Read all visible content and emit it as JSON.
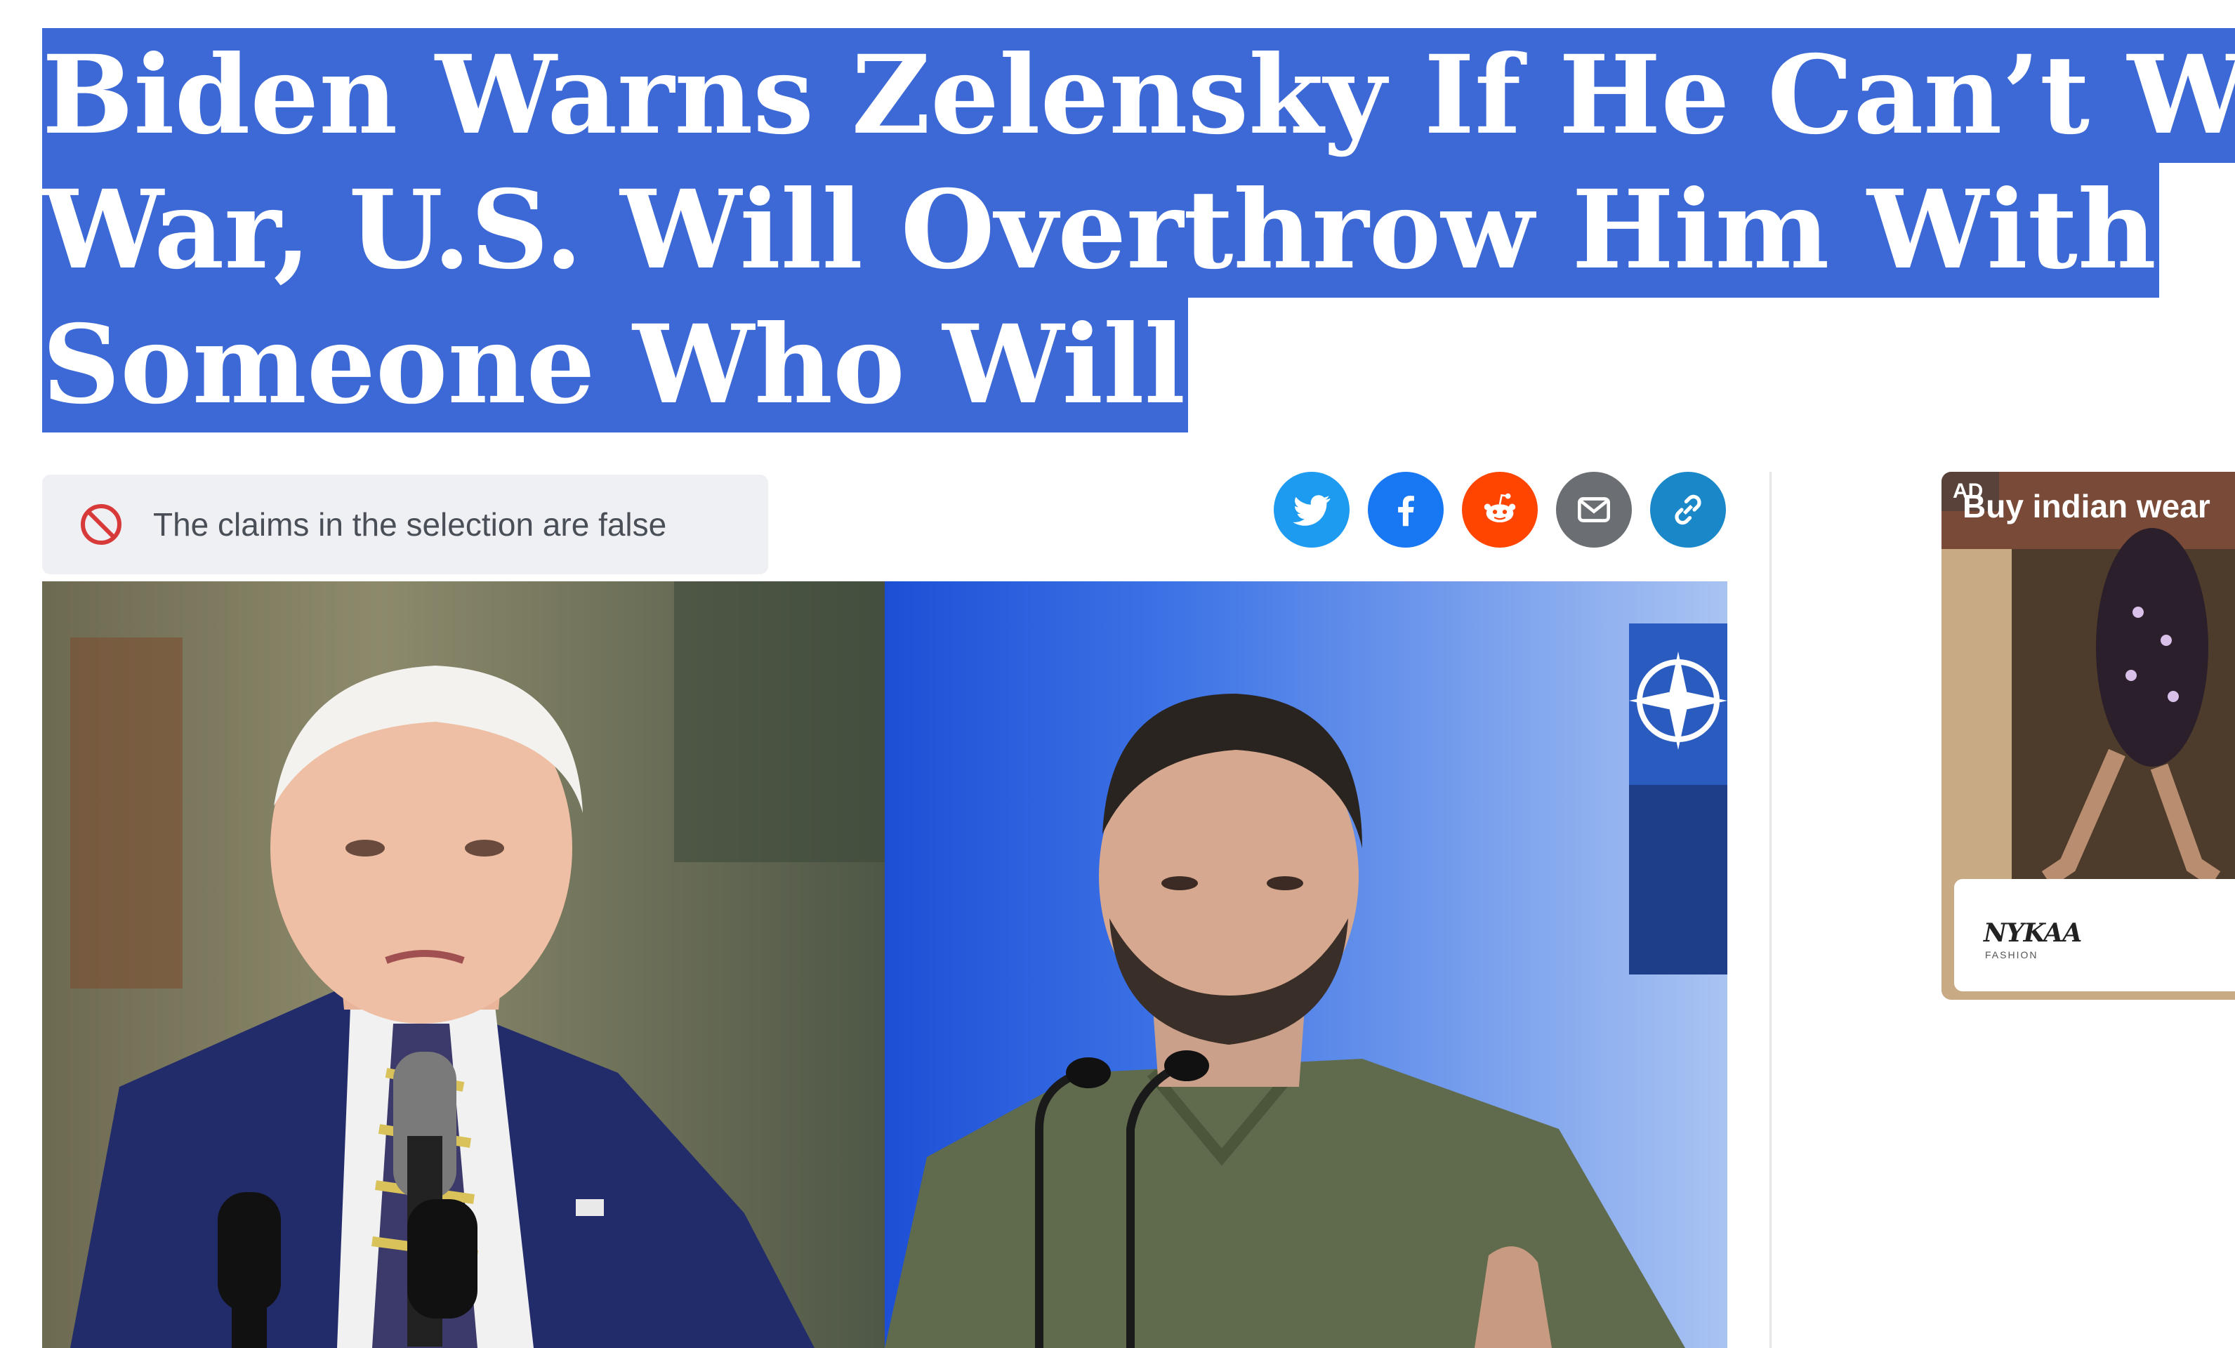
{
  "article": {
    "headline_lines": [
      "Biden Warns Zelensky If He Can’t Win",
      "War, U.S. Will Overthrow Him With",
      "Someone Who Will"
    ]
  },
  "claim": {
    "icon": "prohibited-icon",
    "text": "The claims in the selection are false"
  },
  "share": {
    "buttons": [
      {
        "name": "twitter",
        "icon": "twitter-icon",
        "color": "#1d9bf0"
      },
      {
        "name": "facebook",
        "icon": "facebook-icon",
        "color": "#1877f2"
      },
      {
        "name": "reddit",
        "icon": "reddit-icon",
        "color": "#ff4500"
      },
      {
        "name": "email",
        "icon": "email-icon",
        "color": "#6b6e73"
      },
      {
        "name": "copy-link",
        "icon": "link-icon",
        "color": "#1a87c9"
      }
    ]
  },
  "hero": {
    "left_panel": "photo of Biden speaking at microphones",
    "right_panel": "photo of Zelensky speaking at NATO podium"
  },
  "ad": {
    "badge": "AD",
    "title": "Buy indian wear",
    "brand": "NYKAA",
    "brand_sub": "FASHION"
  },
  "colors": {
    "selection": "#3d69d6",
    "claim_bg": "#eef0f3",
    "prohibited": "#d83a3a"
  }
}
